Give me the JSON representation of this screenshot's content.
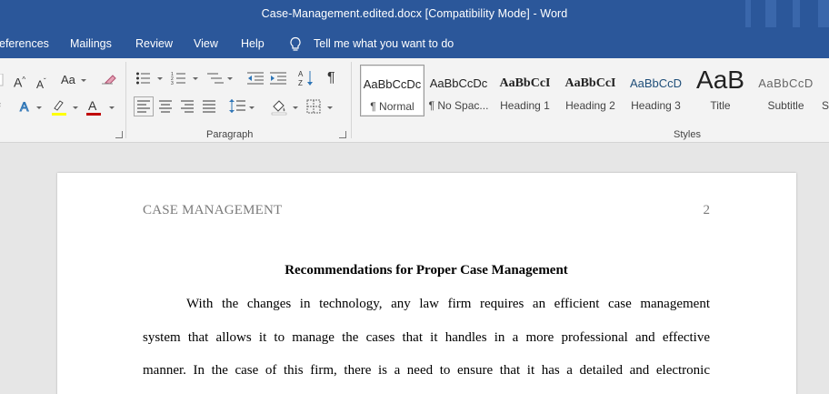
{
  "window": {
    "title": "Case-Management.edited.docx [Compatibility Mode]  -  Word"
  },
  "menu": {
    "tabs": [
      "eferences",
      "Mailings",
      "Review",
      "View",
      "Help"
    ],
    "tell_me": "Tell me what you want to do"
  },
  "ribbon": {
    "font_group": {
      "grow_label": "A",
      "shrink_label": "A",
      "case_label": "Aa"
    },
    "paragraph_group": {
      "label": "Paragraph",
      "pilcrow": "¶"
    },
    "styles_group": {
      "label": "Styles",
      "items": [
        {
          "sample": "AaBbCcDc",
          "name": "¶ Normal"
        },
        {
          "sample": "AaBbCcDc",
          "name": "¶ No Spac..."
        },
        {
          "sample": "AaBbCcI",
          "name": "Heading 1"
        },
        {
          "sample": "AaBbCcI",
          "name": "Heading 2"
        },
        {
          "sample": "AaBbCcD",
          "name": "Heading 3"
        },
        {
          "sample": "AaB",
          "name": "Title"
        },
        {
          "sample": "AaBbCcD",
          "name": "Subtitle"
        },
        {
          "sample": "",
          "name": "S"
        }
      ]
    },
    "colors": {
      "highlight": "#ffff00",
      "font_color": "#c00000"
    }
  },
  "document": {
    "running_head": "CASE MANAGEMENT",
    "page_number": "2",
    "title": "Recommendations for Proper Case Management",
    "lines": [
      "With the changes in technology, any law firm requires an efficient case management",
      "system that allows it to manage the cases that it handles in a more professional and effective",
      "manner. In the case of this firm, there is a need to ensure that it has a detailed and electronic"
    ]
  }
}
